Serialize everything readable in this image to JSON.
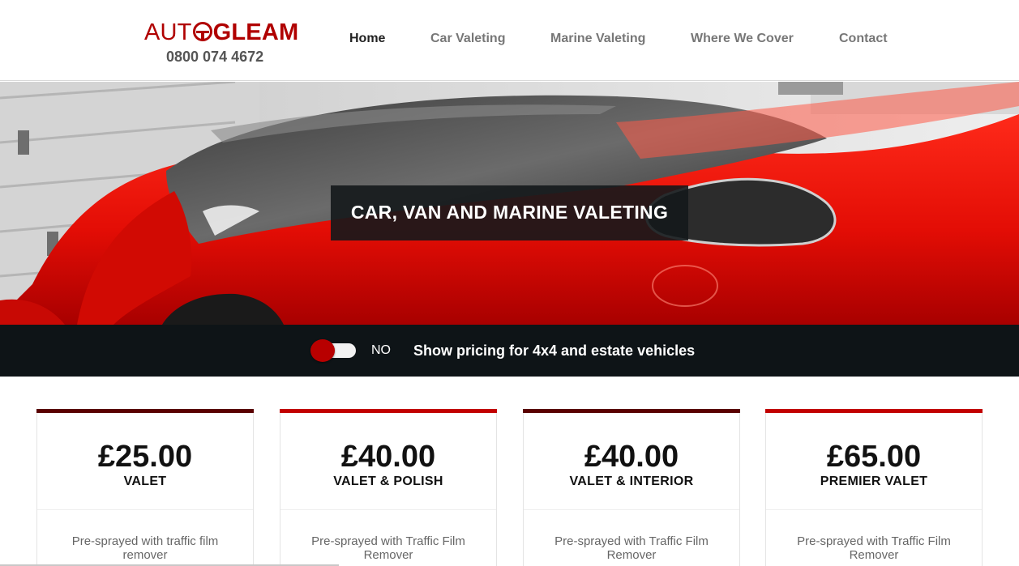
{
  "brand": {
    "logo_part1": "AUT",
    "logo_part2": "GLEAM",
    "logo_icon": "steering-wheel-icon",
    "phone": "0800 074 4672",
    "color": "#b00000"
  },
  "nav": {
    "items": [
      {
        "label": "Home",
        "active": true
      },
      {
        "label": "Car Valeting",
        "active": false
      },
      {
        "label": "Marine Valeting",
        "active": false
      },
      {
        "label": "Where We Cover",
        "active": false
      },
      {
        "label": "Contact",
        "active": false
      }
    ]
  },
  "hero": {
    "title": "CAR, VAN AND MARINE VALETING",
    "image": "red-sports-car-photo"
  },
  "pricing_toggle": {
    "state": "NO",
    "label": "Show pricing for 4x4 and estate vehicles"
  },
  "cards": [
    {
      "price": "£25.00",
      "name": "VALET",
      "description": "Pre-sprayed with traffic film remover",
      "accent": "#5a0000"
    },
    {
      "price": "£40.00",
      "name": "VALET & POLISH",
      "description": "Pre-sprayed with Traffic Film Remover",
      "accent": "#c20000"
    },
    {
      "price": "£40.00",
      "name": "VALET & INTERIOR",
      "description": "Pre-sprayed with Traffic Film Remover",
      "accent": "#5a0000"
    },
    {
      "price": "£65.00",
      "name": "PREMIER VALET",
      "description": "Pre-sprayed with Traffic Film Remover",
      "accent": "#c20000"
    }
  ]
}
